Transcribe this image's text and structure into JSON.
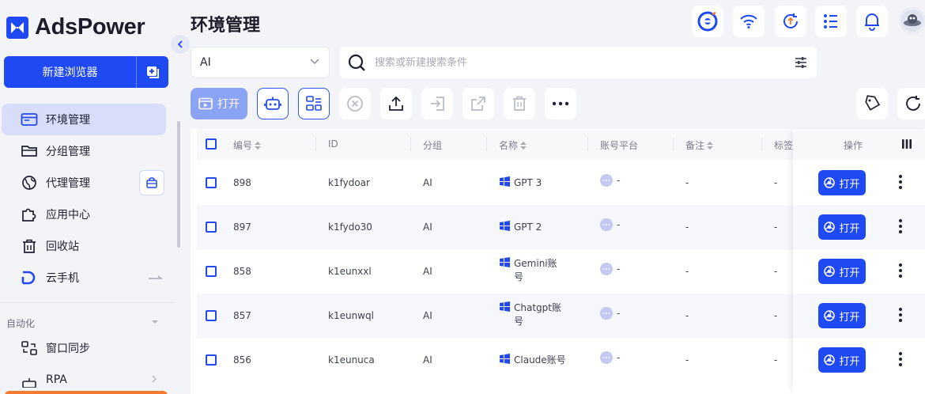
{
  "sidebar": {
    "logo_text": "AdsPower",
    "new_browser_label": "新建浏览器",
    "nav": [
      {
        "label": "环境管理",
        "icon": "browser-window-icon",
        "active": true
      },
      {
        "label": "分组管理",
        "icon": "folder-icon"
      },
      {
        "label": "代理管理",
        "icon": "globe-icon"
      },
      {
        "label": "应用中心",
        "icon": "puzzle-icon"
      },
      {
        "label": "回收站",
        "icon": "trash-icon"
      },
      {
        "label": "云手机",
        "icon": "cloud-phone-icon"
      }
    ],
    "section_automation": "自动化",
    "nav2": [
      {
        "label": "窗口同步",
        "icon": "window-sync-icon"
      },
      {
        "label": "RPA",
        "icon": "rpa-icon"
      }
    ]
  },
  "header": {
    "title": "环境管理",
    "icons": [
      "adspower-ring-icon",
      "wifi-icon",
      "update-icon",
      "task-list-icon",
      "bell-icon",
      "avatar"
    ]
  },
  "filters": {
    "group_value": "AI",
    "search_placeholder": "搜索或新建搜索条件"
  },
  "toolbar": {
    "open_label": "打开",
    "icons": [
      "robot-icon",
      "group-sort-icon",
      "close-circle-icon",
      "upload-icon",
      "import-icon",
      "share-icon",
      "trash-icon",
      "more-icon",
      "tag-icon",
      "refresh-icon"
    ]
  },
  "table": {
    "columns": [
      "编号",
      "ID",
      "分组",
      "名称",
      "账号平台",
      "备注",
      "标签",
      "操作"
    ],
    "rows": [
      {
        "num": "898",
        "id": "k1fydoar",
        "group": "AI",
        "name": "GPT 3",
        "platform": "-",
        "remark": "-",
        "tag": "-"
      },
      {
        "num": "897",
        "id": "k1fydo30",
        "group": "AI",
        "name": "GPT 2",
        "platform": "-",
        "remark": "-",
        "tag": "-"
      },
      {
        "num": "858",
        "id": "k1eunxxl",
        "group": "AI",
        "name": "Gemini账号",
        "platform": "-",
        "remark": "-",
        "tag": "-"
      },
      {
        "num": "857",
        "id": "k1eunwql",
        "group": "AI",
        "name": "Chatgpt账号",
        "platform": "-",
        "remark": "-",
        "tag": "-"
      },
      {
        "num": "856",
        "id": "k1eunuca",
        "group": "AI",
        "name": "Claude账号",
        "platform": "-",
        "remark": "-",
        "tag": "-"
      }
    ],
    "open_label": "打开"
  },
  "colors": {
    "brand": "#1f49f2",
    "sidebar_active": "#d8ddf9",
    "open_disabled": "#8aa3f5",
    "bottom_bar": "#f37a2f"
  }
}
